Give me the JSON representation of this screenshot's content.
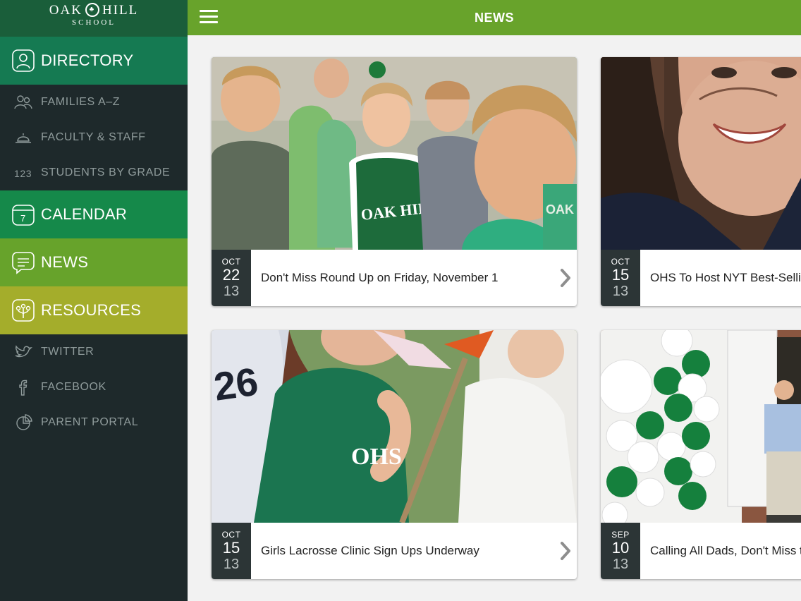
{
  "logo": {
    "name_left": "OAK",
    "name_right": "HILL",
    "sub": "SCHOOL"
  },
  "header": {
    "title": "NEWS"
  },
  "sidebar": {
    "directory": "DIRECTORY",
    "directory_items": [
      "FAMILIES A–Z",
      "FACULTY & STAFF",
      "STUDENTS BY GRADE"
    ],
    "calendar": "CALENDAR",
    "calendar_icon_num": "7",
    "news": "NEWS",
    "resources": "RESOURCES",
    "resource_items": [
      "TWITTER",
      "FACEBOOK",
      "PARENT PORTAL"
    ]
  },
  "cards": [
    {
      "month": "OCT",
      "day": "22",
      "year": "13",
      "headline": "Don't Miss Round Up on Friday, November 1"
    },
    {
      "month": "OCT",
      "day": "15",
      "year": "13",
      "headline": "OHS To Host NYT Best-Selling"
    },
    {
      "month": "OCT",
      "day": "15",
      "year": "13",
      "headline": "Girls Lacrosse Clinic Sign Ups Underway"
    },
    {
      "month": "SEP",
      "day": "10",
      "year": "13",
      "headline": "Calling All Dads, Don't Miss the Meeting!"
    }
  ],
  "photo_text": {
    "shirt1": "OAK HILL",
    "shirt2": "OAK",
    "jersey_num": "26",
    "jersey_text": "OHS"
  },
  "colors": {
    "directory": "#157a52",
    "calendar": "#15894a",
    "news": "#67a32b",
    "resources": "#a4ad2b",
    "sidebar_bg": "#1e292b",
    "topbar": "#68a32b"
  }
}
